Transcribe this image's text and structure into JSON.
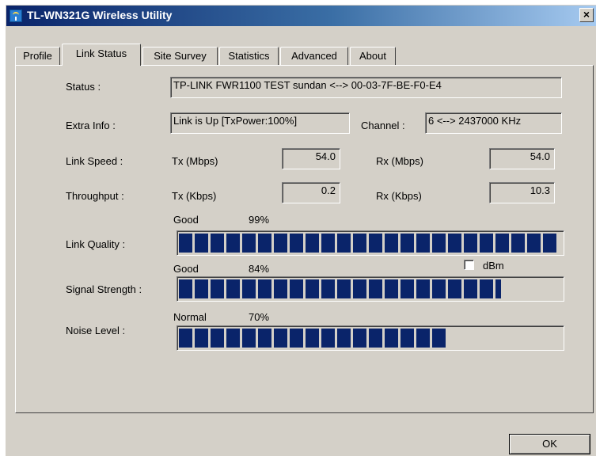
{
  "window": {
    "title": "TL-WN321G Wireless Utility",
    "close_glyph": "×"
  },
  "tabs": [
    {
      "label": "Profile"
    },
    {
      "label": "Link Status"
    },
    {
      "label": "Site Survey"
    },
    {
      "label": "Statistics"
    },
    {
      "label": "Advanced"
    },
    {
      "label": "About"
    }
  ],
  "active_tab": "Link Status",
  "status": {
    "label": "Status :",
    "value": "TP-LINK FWR1100 TEST sundan <--> 00-03-7F-BE-F0-E4"
  },
  "extra_info": {
    "label": "Extra Info :",
    "value": "Link is Up [TxPower:100%]",
    "channel_label": "Channel :",
    "channel_value": "6 <--> 2437000 KHz"
  },
  "link_speed": {
    "label": "Link Speed :",
    "tx_label": "Tx (Mbps)",
    "tx_value": "54.0",
    "rx_label": "Rx (Mbps)",
    "rx_value": "54.0"
  },
  "throughput": {
    "label": "Throughput :",
    "tx_label": "Tx (Kbps)",
    "tx_value": "0.2",
    "rx_label": "Rx (Kbps)",
    "rx_value": "10.3"
  },
  "link_quality": {
    "label": "Link Quality :",
    "grade": "Good",
    "percent_text": "99%",
    "level": 0.99
  },
  "signal_strength": {
    "label": "Signal Strength :",
    "grade": "Good",
    "percent_text": "84%",
    "level": 0.84
  },
  "noise_level": {
    "label": "Noise Level :",
    "grade": "Normal",
    "percent_text": "70%",
    "level": 0.7
  },
  "dbm": {
    "label": "dBm",
    "checked": false
  },
  "ok_button": {
    "label": "OK"
  },
  "colors": {
    "bar_fill": "#0a246a",
    "face": "#d4d0c8",
    "title_start": "#0a246a",
    "title_end": "#a6caf0"
  }
}
